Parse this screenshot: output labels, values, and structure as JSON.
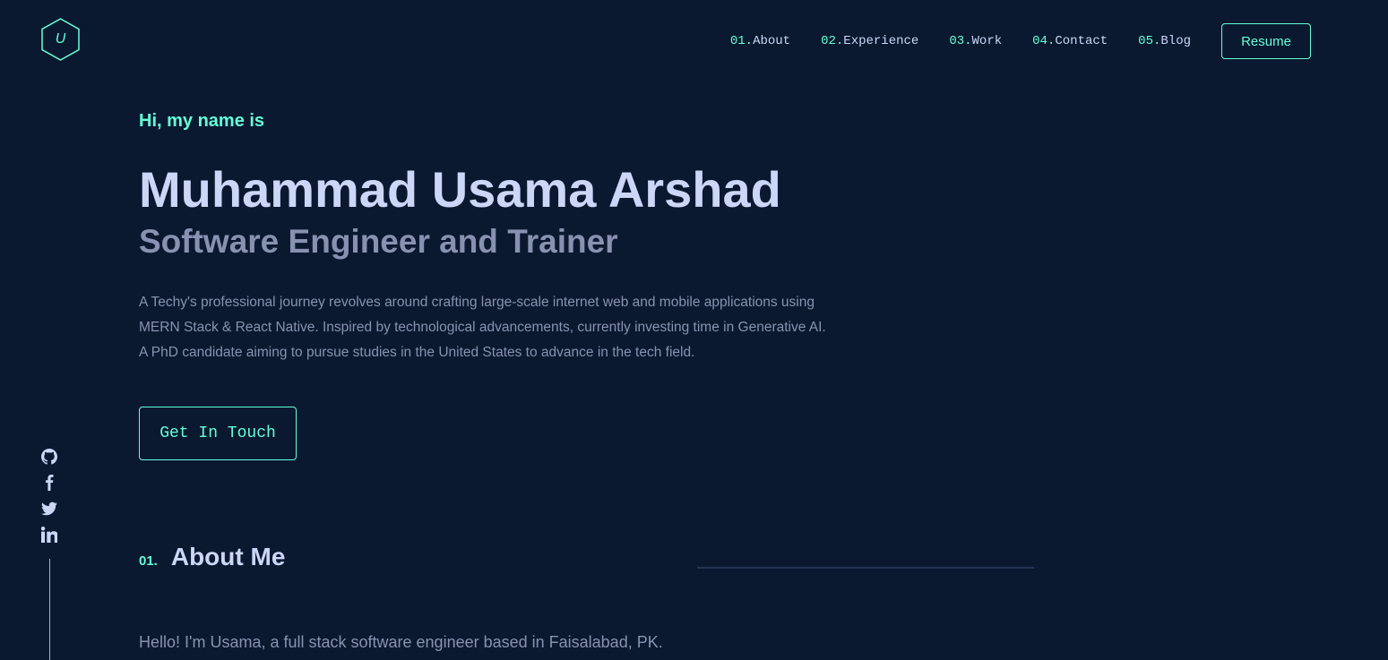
{
  "header": {
    "logo_letter": "U",
    "nav": [
      {
        "num": "01.",
        "label": "About"
      },
      {
        "num": "02.",
        "label": "Experience"
      },
      {
        "num": "03.",
        "label": "Work"
      },
      {
        "num": "04.",
        "label": "Contact"
      },
      {
        "num": "05.",
        "label": "Blog"
      }
    ],
    "resume_label": "Resume"
  },
  "socials": [
    "github-icon",
    "facebook-icon",
    "twitter-icon",
    "linkedin-icon"
  ],
  "hero": {
    "greeting": "Hi, my name is",
    "name": "Muhammad Usama Arshad",
    "subtitle": "Software Engineer and Trainer",
    "bio": [
      "A Techy's professional journey revolves around crafting large-scale internet web and mobile applications using",
      "MERN Stack & React Native. Inspired by technological advancements, currently investing time in Generative AI.",
      "A PhD candidate aiming to pursue studies in the United States to advance in the tech field."
    ],
    "cta_label": "Get In Touch"
  },
  "about": {
    "number": "01.",
    "title": "About Me",
    "intro": "Hello! I'm Usama, a full stack software engineer based in Faisalabad, PK."
  },
  "colors": {
    "background": "#0b1930",
    "accent": "#64ffda",
    "heading": "#ccd6f6",
    "body_text": "#8892b0"
  }
}
